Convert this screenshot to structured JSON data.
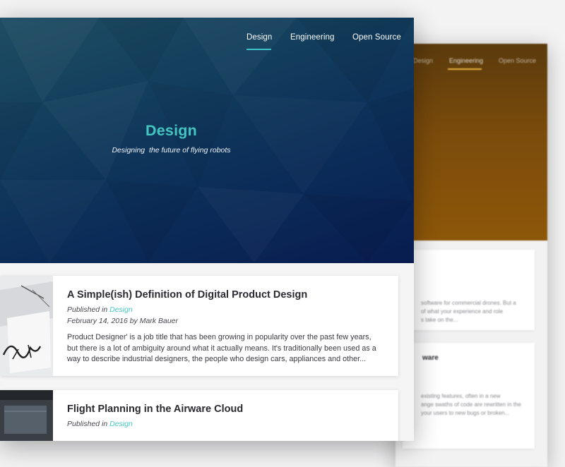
{
  "back_page": {
    "nav": [
      {
        "label": "Design",
        "active": false
      },
      {
        "label": "Engineering",
        "active": true
      },
      {
        "label": "Open Source",
        "active": false
      }
    ],
    "accent_color": "#e8b23e",
    "cards": [
      {
        "lines": [
          "software for commercial drones. But a",
          "of what your experience and role",
          "s take on the..."
        ]
      },
      {
        "title": "ware",
        "lines": [
          "existing features, often in a new",
          "ange swaths of code are rewritten in the",
          "your users to new bugs or broken..."
        ]
      }
    ]
  },
  "front_page": {
    "nav": [
      {
        "label": "Design",
        "active": true
      },
      {
        "label": "Engineering",
        "active": false
      },
      {
        "label": "Open Source",
        "active": false
      }
    ],
    "accent_color": "#3ec3c9",
    "hero": {
      "title": "Design",
      "subtitle": "Designing  the future of flying robots"
    },
    "posts": [
      {
        "title": "A Simple(ish) Definition of Digital Product Design",
        "published_prefix": "Published in ",
        "category": "Design",
        "date_author": "February 14, 2016 by Mark Bauer",
        "excerpt": "Product Designer' is a job title that has been growing in popularity over the past few years, but there is a lot of ambiguity around what it actually means. It's traditionally been used as a way to describe industrial designers, the people who design cars, appliances and other..."
      },
      {
        "title": "Flight Planning in the Airware Cloud",
        "published_prefix": "Published in ",
        "category": "Design"
      }
    ]
  }
}
